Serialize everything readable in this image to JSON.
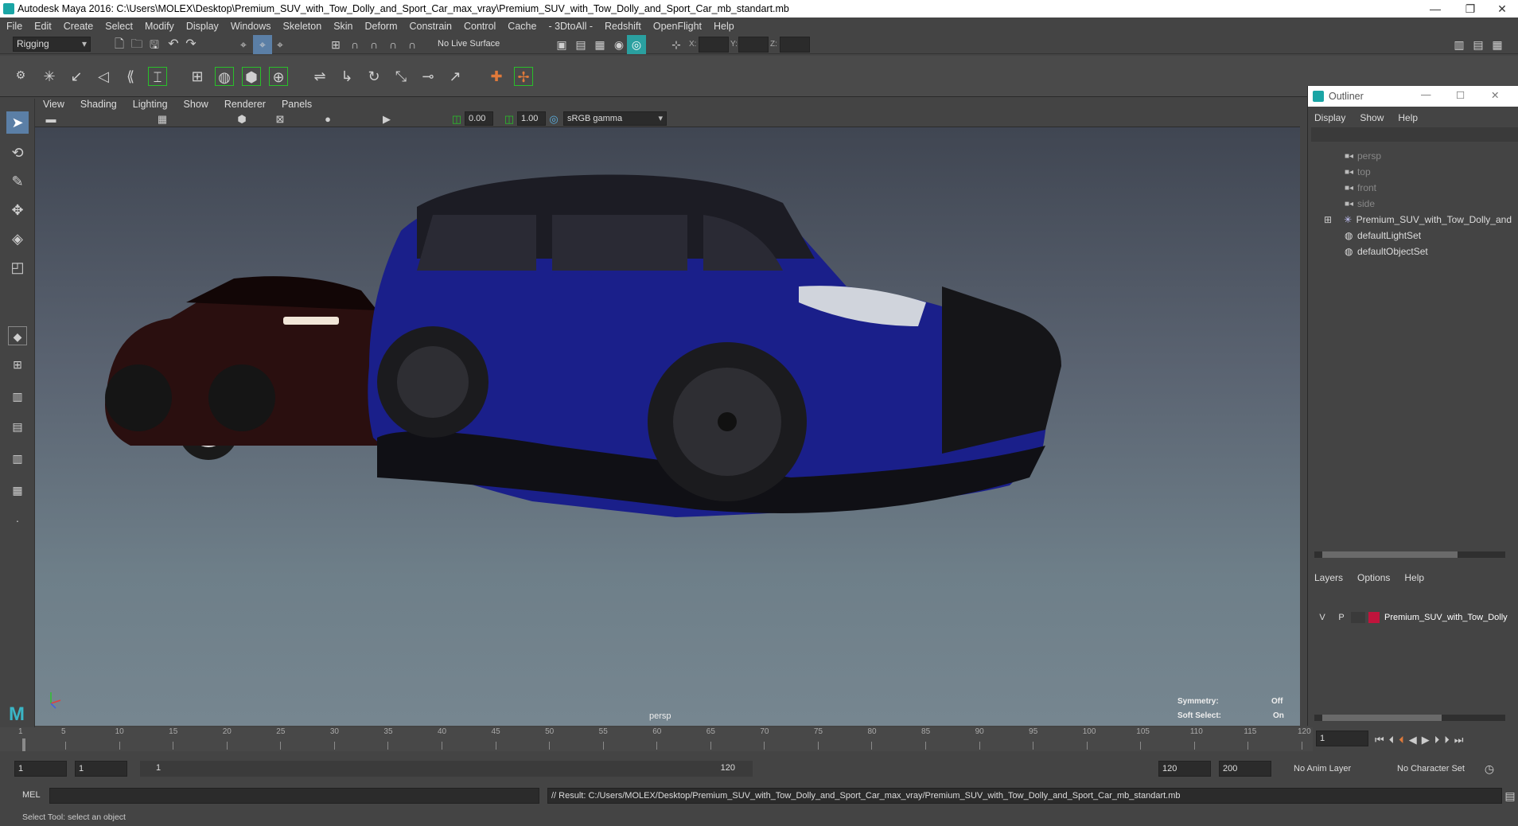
{
  "window": {
    "title": "Autodesk Maya 2016: C:\\Users\\MOLEX\\Desktop\\Premium_SUV_with_Tow_Dolly_and_Sport_Car_max_vray\\Premium_SUV_with_Tow_Dolly_and_Sport_Car_mb_standart.mb",
    "minimize": "—",
    "restore": "❐",
    "close": "✕"
  },
  "menubar": [
    "File",
    "Edit",
    "Create",
    "Select",
    "Modify",
    "Display",
    "Windows",
    "Skeleton",
    "Skin",
    "Deform",
    "Constrain",
    "Control",
    "Cache",
    "- 3DtoAll -",
    "Redshift",
    "OpenFlight",
    "Help"
  ],
  "statusline": {
    "menuset": "Rigging",
    "live_surface": "No Live Surface",
    "x_label": "X:",
    "y_label": "Y:",
    "z_label": "Z:"
  },
  "panel_menu": [
    "View",
    "Shading",
    "Lighting",
    "Show",
    "Renderer",
    "Panels"
  ],
  "panel_toolbar": {
    "exposure": "0.00",
    "gamma": "1.00",
    "color_space": "sRGB gamma"
  },
  "viewport": {
    "camera": "persp",
    "symmetry_label": "Symmetry:",
    "symmetry_value": "Off",
    "soft_select_label": "Soft Select:",
    "soft_select_value": "On"
  },
  "outliner": {
    "title": "Outliner",
    "menu": [
      "Display",
      "Show",
      "Help"
    ],
    "items": [
      {
        "label": "persp",
        "type": "camera",
        "dim": true
      },
      {
        "label": "top",
        "type": "camera",
        "dim": true
      },
      {
        "label": "front",
        "type": "camera",
        "dim": true
      },
      {
        "label": "side",
        "type": "camera",
        "dim": true
      },
      {
        "label": "Premium_SUV_with_Tow_Dolly_and",
        "type": "group",
        "dim": false
      },
      {
        "label": "defaultLightSet",
        "type": "set",
        "dim": false
      },
      {
        "label": "defaultObjectSet",
        "type": "set",
        "dim": false
      }
    ]
  },
  "layers": {
    "menu": [
      "Layers",
      "Options",
      "Help"
    ],
    "layer": {
      "v": "V",
      "p": "P",
      "name": "Premium_SUV_with_Tow_Dolly",
      "color": "#c0143c"
    }
  },
  "timeline": {
    "ticks": [
      "1",
      "5",
      "10",
      "15",
      "20",
      "25",
      "30",
      "35",
      "40",
      "45",
      "50",
      "55",
      "60",
      "65",
      "70",
      "75",
      "80",
      "85",
      "90",
      "95",
      "100",
      "105",
      "110",
      "115",
      "120"
    ],
    "current_frame": "1"
  },
  "range": {
    "start": "1",
    "anim_start": "1",
    "slider_start": "1",
    "slider_end": "120",
    "end": "120",
    "anim_end": "200",
    "anim_layer": "No Anim Layer",
    "char_set": "No Character Set"
  },
  "command": {
    "lang": "MEL",
    "result": "// Result: C:/Users/MOLEX/Desktop/Premium_SUV_with_Tow_Dolly_and_Sport_Car_max_vray/Premium_SUV_with_Tow_Dolly_and_Sport_Car_mb_standart.mb"
  },
  "help_line": "Select Tool: select an object",
  "colors": {
    "suv": "#1a1f8a",
    "sportcar": "#2a0f0f",
    "dolly": "#e2562a"
  }
}
